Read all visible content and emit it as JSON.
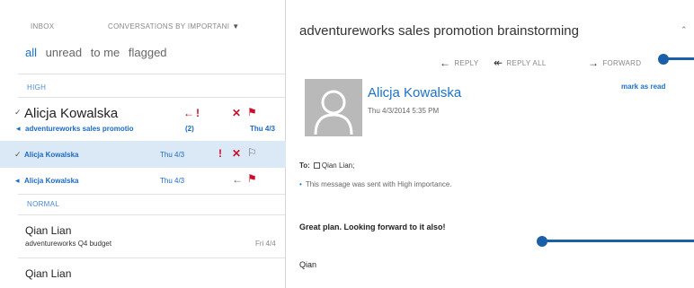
{
  "list_header": {
    "folder": "INBOX",
    "sort_label": "CONVERSATIONS BY IMPORTANI"
  },
  "filters": [
    "all",
    "unread",
    "to me",
    "flagged"
  ],
  "sections": {
    "high": "HIGH",
    "normal": "NORMAL"
  },
  "thread": {
    "from": "Alicja Kowalska",
    "subject": "adventureworks sales promotio",
    "count": "(2)",
    "date": "Thu 4/3"
  },
  "thread_items": [
    {
      "from": "Alicja Kowalska",
      "date": "Thu 4/3"
    },
    {
      "from": "Alicja Kowalska",
      "date": "Thu 4/3"
    }
  ],
  "normal_items": [
    {
      "from": "Qian Lian",
      "subject": "adventureworks Q4 budget",
      "date": "Fri 4/4"
    },
    {
      "from": "Qian Lian"
    }
  ],
  "reading": {
    "subject": "adventureworks sales promotion brainstorming",
    "actions": {
      "reply": "REPLY",
      "reply_all": "REPLY ALL",
      "forward": "FORWARD"
    },
    "sender": "Alicja Kowalska",
    "sent": "Thu 4/3/2014 5:35 PM",
    "mark_as_read": "mark as read",
    "to_label": "To:",
    "to_name": "Qian Lian;",
    "importance_note": "This message was sent with High importance.",
    "body_line": "Great plan. Looking forward to it also!",
    "signature": "Qian"
  },
  "colors": {
    "accent": "#1b73c9",
    "selected_bg": "#dbe8f6",
    "flag_red": "#c8102e",
    "callout": "#1b5fa8"
  },
  "icons": [
    "reply-icon",
    "reply-all-icon",
    "forward-icon",
    "flag-icon",
    "delete-icon",
    "importance-icon",
    "chevron-icon",
    "collapse-icon",
    "avatar-icon"
  ]
}
